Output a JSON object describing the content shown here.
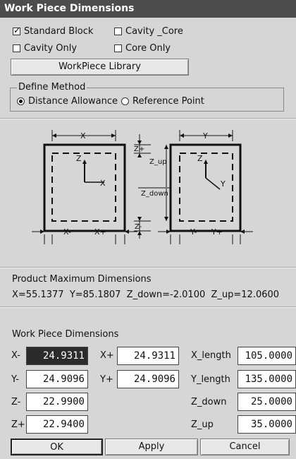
{
  "window": {
    "title": "Work Piece Dimensions"
  },
  "options": {
    "standard_block": {
      "label": "Standard Block",
      "checked": true
    },
    "cavity_core": {
      "label": "Cavity _Core",
      "checked": false
    },
    "cavity_only": {
      "label": "Cavity Only",
      "checked": false
    },
    "core_only": {
      "label": "Core Only",
      "checked": false
    }
  },
  "library_button": "WorkPiece Library",
  "define_method": {
    "legend": "Define Method",
    "distance_allowance": {
      "label": "Distance Allowance",
      "selected": true
    },
    "reference_point": {
      "label": "Reference Point",
      "selected": false
    }
  },
  "diagram": {
    "x": "X",
    "y": "Y",
    "zplus": "Z+",
    "zminus": "Z-",
    "zup": "Z_up",
    "zdown": "Z_down",
    "z": "Z",
    "xminus": "X-",
    "xplus": "X+",
    "yminus": "Y-",
    "yplus": "Y+"
  },
  "product_max": {
    "heading": "Product Maximum Dimensions",
    "values": "X=55.1377  Y=85.1807  Z_down=-2.0100  Z_up=12.0600"
  },
  "work_piece": {
    "heading": "Work Piece Dimensions",
    "x_minus": {
      "label": "X-",
      "value": "24.9311"
    },
    "x_plus": {
      "label": "X+",
      "value": "24.9311"
    },
    "x_length": {
      "label": "X_length",
      "value": "105.0000"
    },
    "y_minus": {
      "label": "Y-",
      "value": "24.9096"
    },
    "y_plus": {
      "label": "Y+",
      "value": "24.9096"
    },
    "y_length": {
      "label": "Y_length",
      "value": "135.0000"
    },
    "z_minus": {
      "label": "Z-",
      "value": "22.9900"
    },
    "z_down": {
      "label": "Z_down",
      "value": "25.0000"
    },
    "z_plus": {
      "label": "Z+",
      "value": "22.9400"
    },
    "z_up": {
      "label": "Z_up",
      "value": "35.0000"
    }
  },
  "buttons": {
    "ok": "OK",
    "apply": "Apply",
    "cancel": "Cancel"
  }
}
